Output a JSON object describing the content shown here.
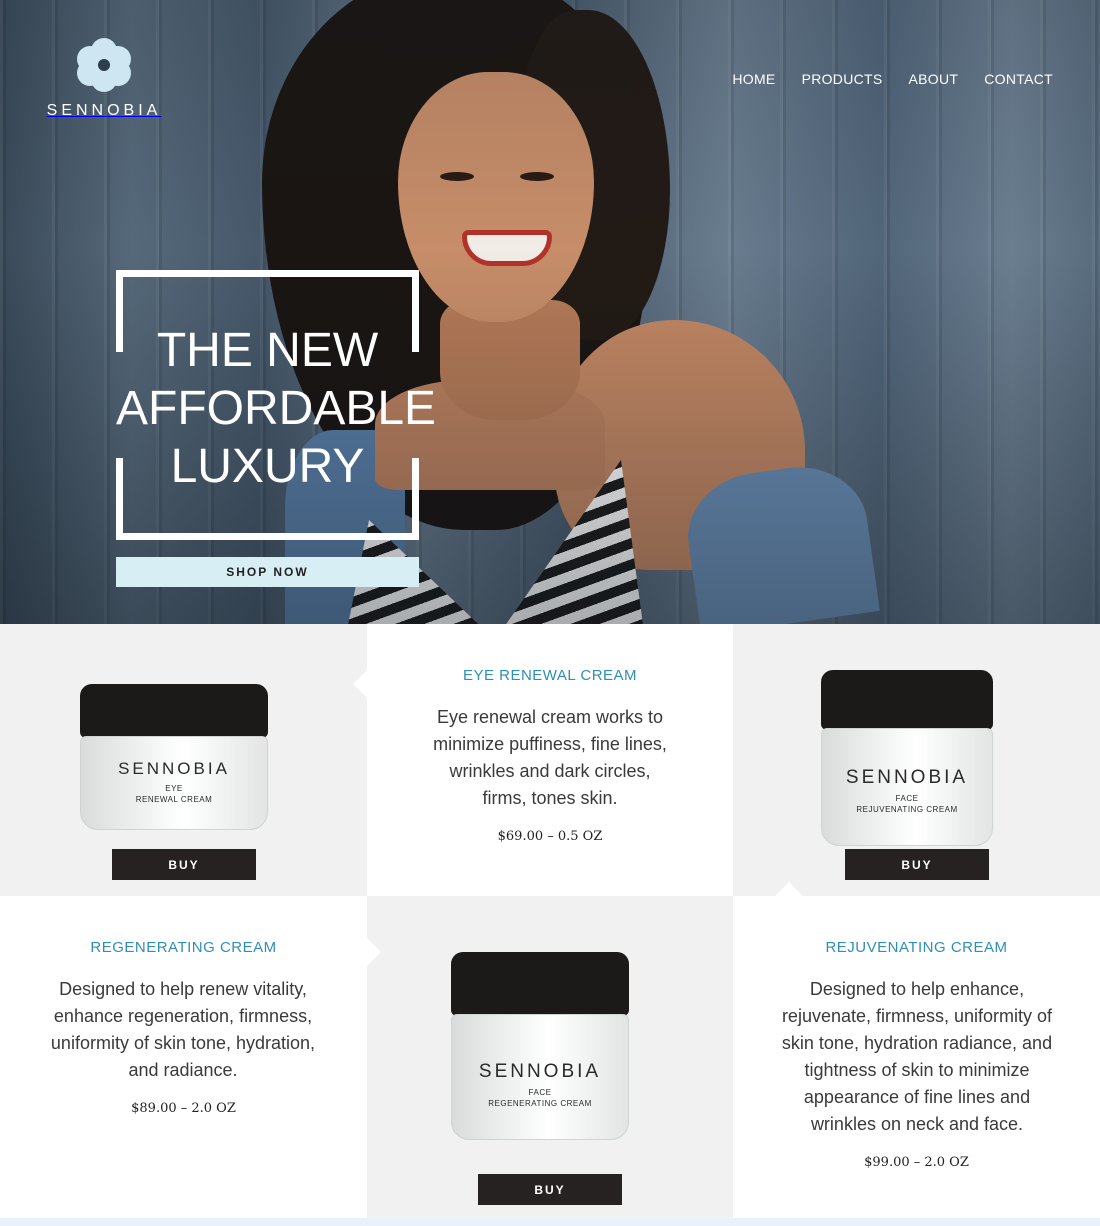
{
  "brand": {
    "name": "SENNOBIA"
  },
  "nav": {
    "items": [
      "HOME",
      "PRODUCTS",
      "ABOUT",
      "CONTACT"
    ]
  },
  "hero": {
    "headline_lines": [
      "THE NEW",
      "AFFORDABLE",
      "LUXURY"
    ],
    "cta_label": "SHOP NOW"
  },
  "products": [
    {
      "title": "EYE RENEWAL CREAM",
      "description": "Eye renewal cream works to minimize puffiness, fine lines, wrinkles and dark circles, firms, tones skin.",
      "price": "$69.00 – 0.5 OZ",
      "jar_brand": "SENNOBIA",
      "jar_line1": "EYE",
      "jar_line2": "RENEWAL CREAM",
      "buy_label": "BUY"
    },
    {
      "title": "REGENERATING CREAM",
      "description": "Designed to help renew vitality, enhance regeneration, firmness, uniformity of skin tone, hydration, and radiance.",
      "price": "$89.00 – 2.0 OZ",
      "jar_brand": "SENNOBIA",
      "jar_line1": "FACE",
      "jar_line2": "REGENERATING CREAM",
      "buy_label": "BUY"
    },
    {
      "title": "REJUVENATING CREAM",
      "description": "Designed to help enhance, rejuvenate, firmness, uniformity of skin tone, hydration radiance, and tightness of skin to minimize appearance of fine lines and wrinkles on neck and face.",
      "price": "$99.00 – 2.0 OZ",
      "jar_brand": "SENNOBIA",
      "jar_line1": "FACE",
      "jar_line2": "REJUVENATING CREAM",
      "buy_label": "BUY"
    }
  ],
  "colors": {
    "accent_title": "#2f8fb3",
    "cta_background": "#d7eef5",
    "buy_background": "#262221",
    "logo_petal": "#cde6f1"
  }
}
